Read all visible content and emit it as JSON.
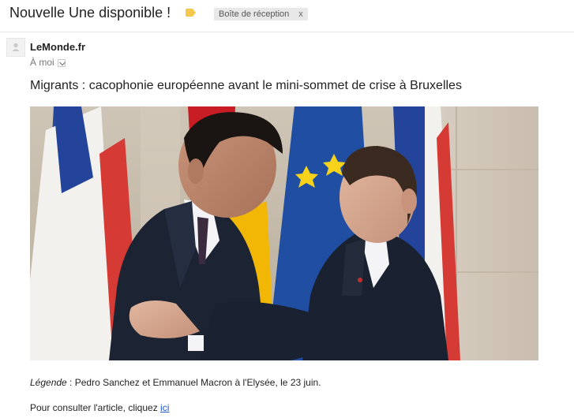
{
  "header": {
    "subject": "Nouvelle Une disponible !",
    "label_icon": "label-tag-icon",
    "label_color": "#f2c94c",
    "inbox_chip": {
      "label": "Boîte de réception",
      "remove": "x"
    }
  },
  "message": {
    "avatar_icon": "person-icon",
    "sender": "LeMonde.fr",
    "recipient": "À moi",
    "headline": "Migrants : cacophonie européenne avant le mini-sommet de crise à Bruxelles",
    "image_alt": "Photo: Pedro Sanchez et Emmanuel Macron",
    "caption_label": "Légende",
    "caption_text": " : Pedro Sanchez et Emmanuel Macron à l'Elysée, le 23 juin.",
    "cta_text": "Pour consulter l'article, cliquez ",
    "cta_link": "ici"
  },
  "colors": {
    "link": "#1a55c5",
    "chip_bg": "#e8e8e8"
  }
}
